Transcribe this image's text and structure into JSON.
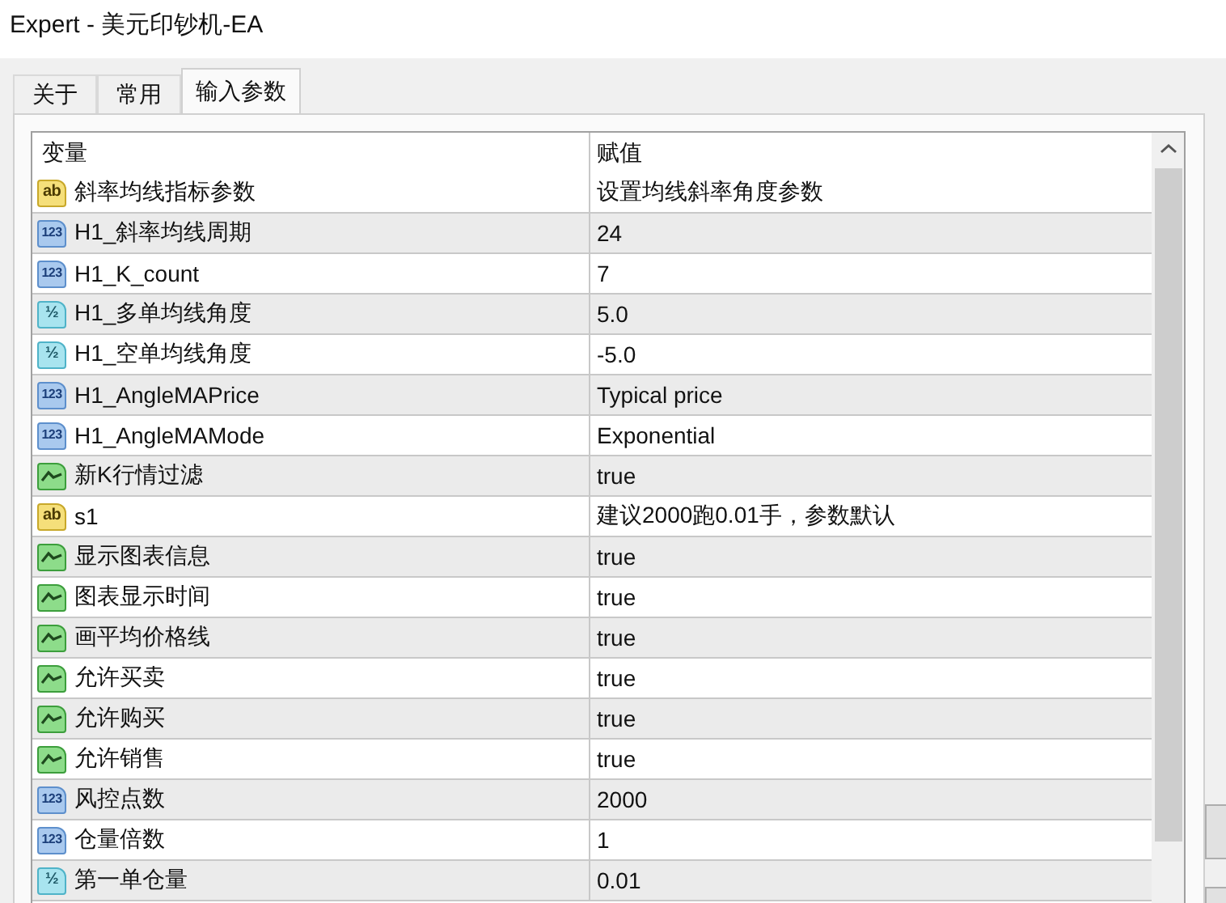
{
  "window": {
    "title": "Expert - 美元印钞机-EA"
  },
  "tabs": [
    {
      "label": "关于",
      "selected": false
    },
    {
      "label": "常用",
      "selected": false
    },
    {
      "label": "输入参数",
      "selected": true
    }
  ],
  "table": {
    "columns": [
      "变量",
      "赋值"
    ],
    "rows": [
      {
        "kind": "string",
        "icon_label": "ab",
        "name": "斜率均线指标参数",
        "value": "设置均线斜率角度参数"
      },
      {
        "kind": "int",
        "icon_label": "123",
        "name": "H1_斜率均线周期",
        "value": "24"
      },
      {
        "kind": "int",
        "icon_label": "123",
        "name": "H1_K_count",
        "value": "7"
      },
      {
        "kind": "double",
        "icon_label": "½",
        "name": "H1_多单均线角度",
        "value": "5.0"
      },
      {
        "kind": "double",
        "icon_label": "½",
        "name": "H1_空单均线角度",
        "value": "-5.0"
      },
      {
        "kind": "int",
        "icon_label": "123",
        "name": "H1_AngleMAPrice",
        "value": "Typical price"
      },
      {
        "kind": "int",
        "icon_label": "123",
        "name": "H1_AngleMAMode",
        "value": "Exponential"
      },
      {
        "kind": "bool",
        "name": "新K行情过滤",
        "value": "true"
      },
      {
        "kind": "string",
        "icon_label": "ab",
        "name": "s1",
        "value": "建议2000跑0.01手，参数默认"
      },
      {
        "kind": "bool",
        "name": "显示图表信息",
        "value": "true"
      },
      {
        "kind": "bool",
        "name": "图表显示时间",
        "value": "true"
      },
      {
        "kind": "bool",
        "name": "画平均价格线",
        "value": "true"
      },
      {
        "kind": "bool",
        "name": "允许买卖",
        "value": "true"
      },
      {
        "kind": "bool",
        "name": "允许购买",
        "value": "true"
      },
      {
        "kind": "bool",
        "name": "允许销售",
        "value": "true"
      },
      {
        "kind": "int",
        "icon_label": "123",
        "name": "风控点数",
        "value": "2000"
      },
      {
        "kind": "int",
        "icon_label": "123",
        "name": "仓量倍数",
        "value": "1"
      },
      {
        "kind": "double",
        "icon_label": "½",
        "name": "第一单仓量",
        "value": "0.01"
      }
    ]
  }
}
